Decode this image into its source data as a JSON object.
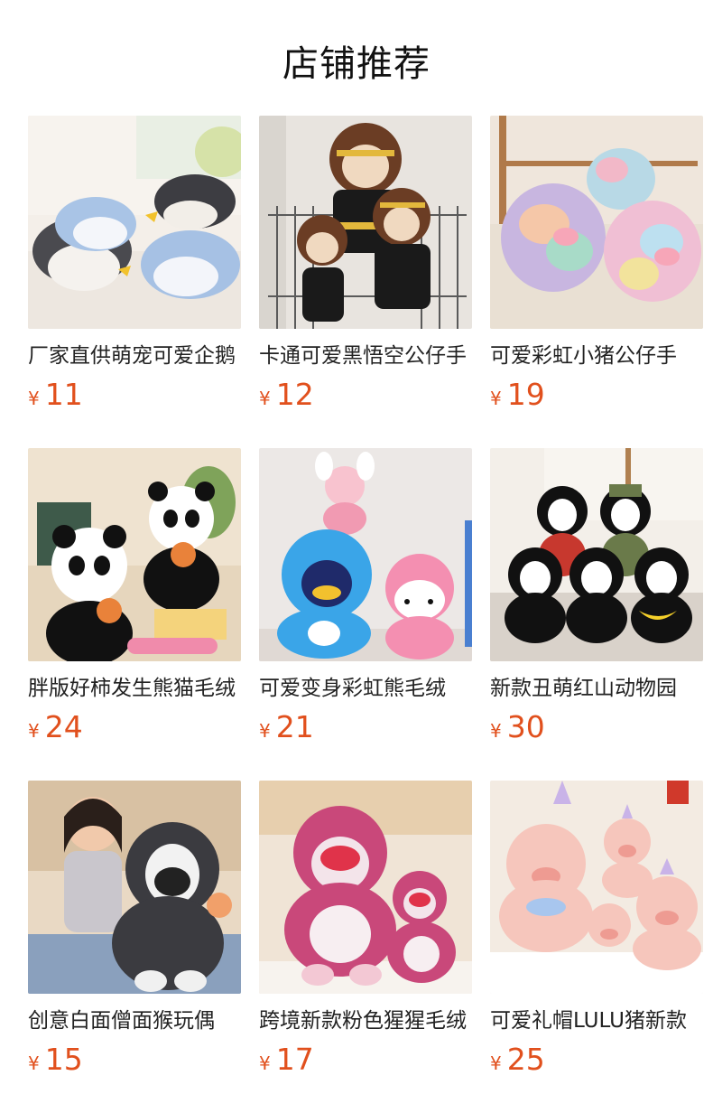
{
  "header": {
    "title": "店铺推荐"
  },
  "products": [
    {
      "name": "厂家直供萌宠可爱企鹅",
      "currency": "¥",
      "price": "11",
      "image_icon": "penguin-plush-photo"
    },
    {
      "name": "卡通可爱黑悟空公仔手",
      "currency": "¥",
      "price": "12",
      "image_icon": "monkey-king-plush-photo"
    },
    {
      "name": "可爱彩虹小猪公仔手",
      "currency": "¥",
      "price": "19",
      "image_icon": "rainbow-pig-plush-photo"
    },
    {
      "name": "胖版好柿发生熊猫毛绒",
      "currency": "¥",
      "price": "24",
      "image_icon": "panda-plush-photo"
    },
    {
      "name": "可爱变身彩虹熊毛绒",
      "currency": "¥",
      "price": "21",
      "image_icon": "rainbow-bear-plush-photo"
    },
    {
      "name": "新款丑萌红山动物园",
      "currency": "¥",
      "price": "30",
      "image_icon": "black-monkey-plush-photo"
    },
    {
      "name": "创意白面僧面猴玩偶",
      "currency": "¥",
      "price": "15",
      "image_icon": "gray-monkey-plush-photo"
    },
    {
      "name": "跨境新款粉色猩猩毛绒",
      "currency": "¥",
      "price": "17",
      "image_icon": "pink-gorilla-plush-photo"
    },
    {
      "name": "可爱礼帽LULU猪新款",
      "currency": "¥",
      "price": "25",
      "image_icon": "lulu-pig-plush-photo"
    }
  ]
}
